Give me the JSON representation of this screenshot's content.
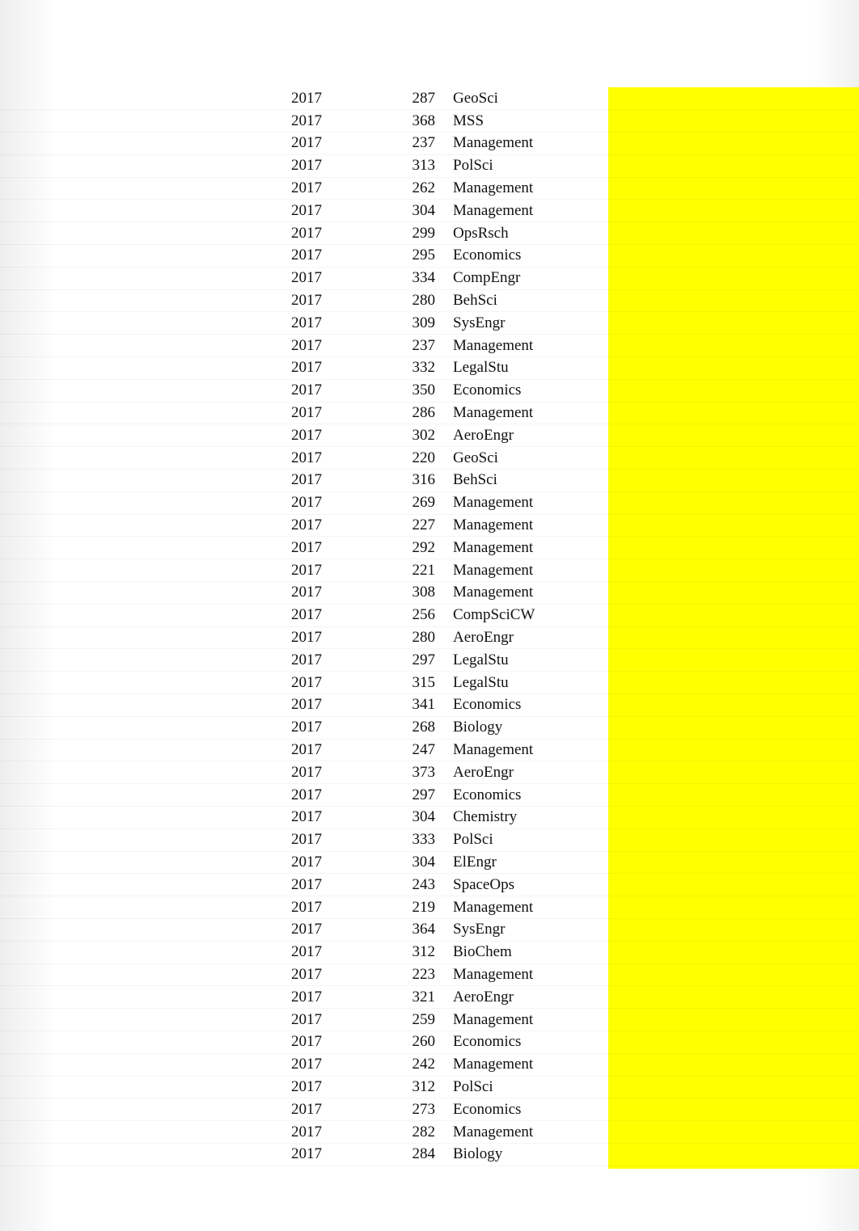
{
  "rows": [
    {
      "year": "2017",
      "value": "287",
      "label": "GeoSci"
    },
    {
      "year": "2017",
      "value": "368",
      "label": "MSS"
    },
    {
      "year": "2017",
      "value": "237",
      "label": "Management"
    },
    {
      "year": "2017",
      "value": "313",
      "label": "PolSci"
    },
    {
      "year": "2017",
      "value": "262",
      "label": "Management"
    },
    {
      "year": "2017",
      "value": "304",
      "label": "Management"
    },
    {
      "year": "2017",
      "value": "299",
      "label": "OpsRsch"
    },
    {
      "year": "2017",
      "value": "295",
      "label": "Economics"
    },
    {
      "year": "2017",
      "value": "334",
      "label": "CompEngr"
    },
    {
      "year": "2017",
      "value": "280",
      "label": "BehSci"
    },
    {
      "year": "2017",
      "value": "309",
      "label": "SysEngr"
    },
    {
      "year": "2017",
      "value": "237",
      "label": "Management"
    },
    {
      "year": "2017",
      "value": "332",
      "label": "LegalStu"
    },
    {
      "year": "2017",
      "value": "350",
      "label": "Economics"
    },
    {
      "year": "2017",
      "value": "286",
      "label": "Management"
    },
    {
      "year": "2017",
      "value": "302",
      "label": "AeroEngr"
    },
    {
      "year": "2017",
      "value": "220",
      "label": "GeoSci"
    },
    {
      "year": "2017",
      "value": "316",
      "label": "BehSci"
    },
    {
      "year": "2017",
      "value": "269",
      "label": "Management"
    },
    {
      "year": "2017",
      "value": "227",
      "label": "Management"
    },
    {
      "year": "2017",
      "value": "292",
      "label": "Management"
    },
    {
      "year": "2017",
      "value": "221",
      "label": "Management"
    },
    {
      "year": "2017",
      "value": "308",
      "label": "Management"
    },
    {
      "year": "2017",
      "value": "256",
      "label": "CompSciCW"
    },
    {
      "year": "2017",
      "value": "280",
      "label": "AeroEngr"
    },
    {
      "year": "2017",
      "value": "297",
      "label": "LegalStu"
    },
    {
      "year": "2017",
      "value": "315",
      "label": "LegalStu"
    },
    {
      "year": "2017",
      "value": "341",
      "label": "Economics"
    },
    {
      "year": "2017",
      "value": "268",
      "label": "Biology"
    },
    {
      "year": "2017",
      "value": "247",
      "label": "Management"
    },
    {
      "year": "2017",
      "value": "373",
      "label": "AeroEngr"
    },
    {
      "year": "2017",
      "value": "297",
      "label": "Economics"
    },
    {
      "year": "2017",
      "value": "304",
      "label": "Chemistry"
    },
    {
      "year": "2017",
      "value": "333",
      "label": "PolSci"
    },
    {
      "year": "2017",
      "value": "304",
      "label": "ElEngr"
    },
    {
      "year": "2017",
      "value": "243",
      "label": "SpaceOps"
    },
    {
      "year": "2017",
      "value": "219",
      "label": "Management"
    },
    {
      "year": "2017",
      "value": "364",
      "label": "SysEngr"
    },
    {
      "year": "2017",
      "value": "312",
      "label": "BioChem"
    },
    {
      "year": "2017",
      "value": "223",
      "label": "Management"
    },
    {
      "year": "2017",
      "value": "321",
      "label": "AeroEngr"
    },
    {
      "year": "2017",
      "value": "259",
      "label": "Management"
    },
    {
      "year": "2017",
      "value": "260",
      "label": "Economics"
    },
    {
      "year": "2017",
      "value": "242",
      "label": "Management"
    },
    {
      "year": "2017",
      "value": "312",
      "label": "PolSci"
    },
    {
      "year": "2017",
      "value": "273",
      "label": "Economics"
    },
    {
      "year": "2017",
      "value": "282",
      "label": "Management"
    },
    {
      "year": "2017",
      "value": "284",
      "label": "Biology"
    }
  ]
}
